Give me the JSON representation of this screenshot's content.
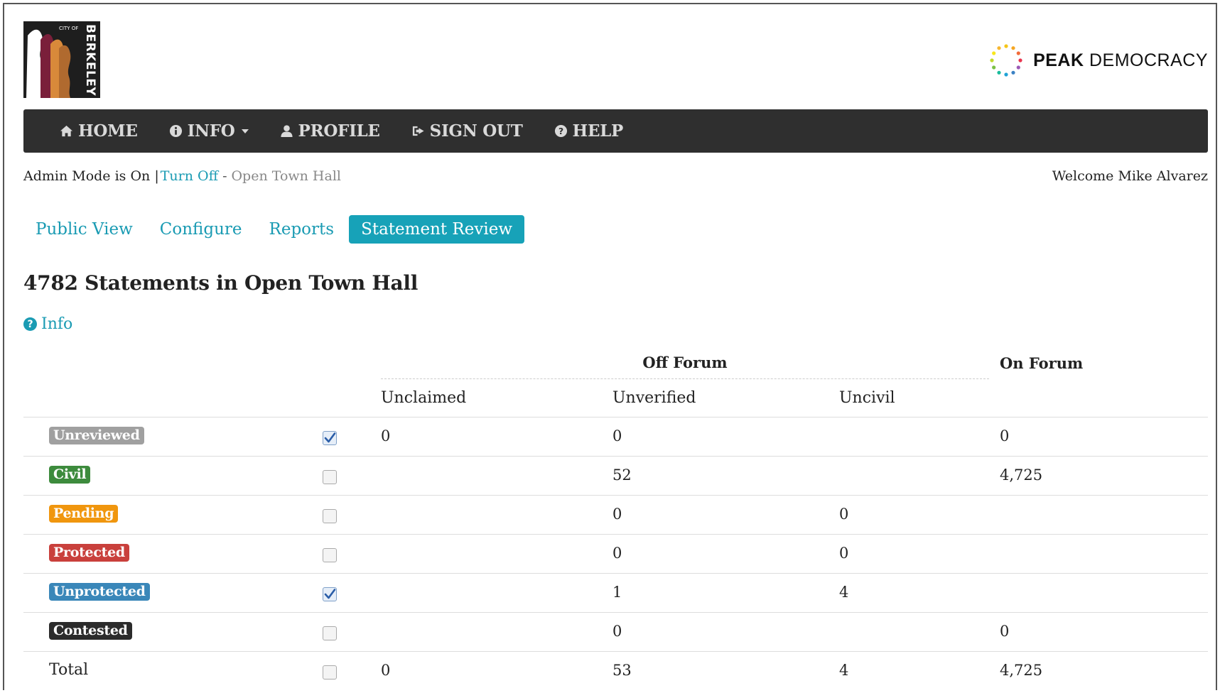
{
  "header": {
    "city_logo_small": "CITY OF",
    "city_logo_name": "BERKELEY",
    "brand_bold": "PEAK",
    "brand_light": "DEMOCRACY"
  },
  "nav": [
    {
      "label": "HOME",
      "icon": "home-icon"
    },
    {
      "label": "INFO",
      "icon": "info-circle-icon",
      "dropdown": true
    },
    {
      "label": "PROFILE",
      "icon": "user-icon"
    },
    {
      "label": "SIGN OUT",
      "icon": "sign-out-icon"
    },
    {
      "label": "HELP",
      "icon": "question-circle-icon"
    }
  ],
  "admin": {
    "status": "Admin Mode is On |",
    "turn_off": "Turn Off",
    "separator": "-",
    "forum": "Open Town Hall",
    "welcome": "Welcome Mike Alvarez"
  },
  "tabs": [
    {
      "label": "Public View",
      "active": false
    },
    {
      "label": "Configure",
      "active": false
    },
    {
      "label": "Reports",
      "active": false
    },
    {
      "label": "Statement Review",
      "active": true
    }
  ],
  "page": {
    "title": "4782 Statements in Open Town Hall",
    "info_label": "Info"
  },
  "table": {
    "group_off": "Off Forum",
    "group_on": "On Forum",
    "columns": [
      "Unclaimed",
      "Unverified",
      "Uncivil"
    ],
    "rows": [
      {
        "label": "Unreviewed",
        "color": "#a0a0a0",
        "checked": true,
        "unclaimed": "0",
        "unverified": "0",
        "uncivil": "",
        "on_forum": "0"
      },
      {
        "label": "Civil",
        "color": "#3d8b3d",
        "checked": false,
        "unclaimed": "",
        "unverified": "52",
        "uncivil": "",
        "on_forum": "4,725"
      },
      {
        "label": "Pending",
        "color": "#f0960e",
        "checked": false,
        "unclaimed": "",
        "unverified": "0",
        "uncivil": "0",
        "on_forum": ""
      },
      {
        "label": "Protected",
        "color": "#c9403c",
        "checked": false,
        "unclaimed": "",
        "unverified": "0",
        "uncivil": "0",
        "on_forum": ""
      },
      {
        "label": "Unprotected",
        "color": "#3a87b9",
        "checked": true,
        "unclaimed": "",
        "unverified": "1",
        "uncivil": "4",
        "on_forum": ""
      },
      {
        "label": "Contested",
        "color": "#2b2b2b",
        "checked": false,
        "unclaimed": "",
        "unverified": "0",
        "uncivil": "",
        "on_forum": "0"
      }
    ],
    "total": {
      "label": "Total",
      "checked": false,
      "unclaimed": "0",
      "unverified": "53",
      "uncivil": "4",
      "on_forum": "4,725"
    }
  }
}
